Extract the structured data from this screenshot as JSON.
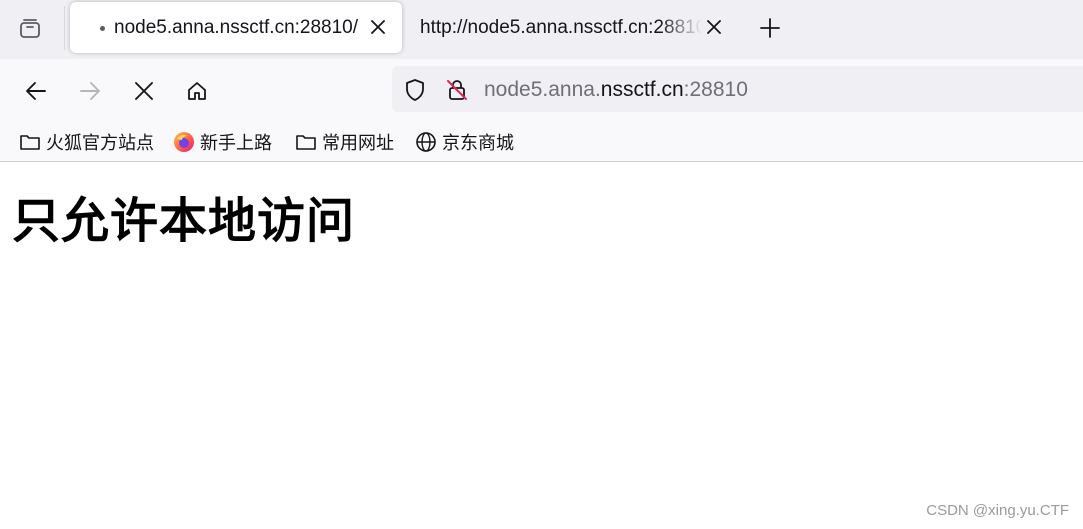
{
  "tabs": [
    {
      "title": "node5.anna.nssctf.cn:28810/",
      "active": true,
      "loading": true
    },
    {
      "title": "http://node5.anna.nssctf.cn:28810",
      "active": false
    }
  ],
  "urlbar": {
    "url_prefix": "node5.anna.",
    "url_domain": "nssctf.cn",
    "url_suffix": ":28810"
  },
  "bookmarks": [
    {
      "label": "火狐官方站点",
      "icon": "folder-icon"
    },
    {
      "label": "新手上路",
      "icon": "firefox-logo-icon"
    },
    {
      "label": "常用网址",
      "icon": "folder-icon"
    },
    {
      "label": "京东商城",
      "icon": "globe-icon"
    }
  ],
  "page": {
    "heading": "只允许本地访问"
  },
  "watermark": "CSDN @xing.yu.CTF",
  "colors": {
    "tabbar_bg": "#f0f0f4",
    "toolbar_bg": "#f9f9fb",
    "text": "#15141a",
    "dim_text": "#6e6e78"
  }
}
